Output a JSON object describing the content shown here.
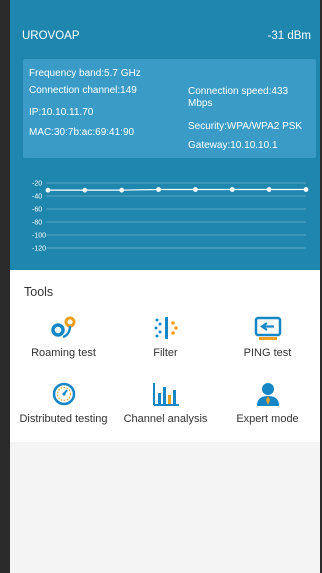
{
  "header": {
    "ssid": "UROVOAP",
    "signal_strength": "-31 dBm"
  },
  "info": {
    "frequency_band": "Frequency band:5.7 GHz",
    "connection_channel": "Connection channel:149",
    "ip": "IP:10.10.11.70",
    "mac": "MAC:30:7b:ac:69:41:90",
    "connection_speed_line1": "Connection speed:433",
    "connection_speed_line2": "Mbps",
    "security": "Security:WPA/WPA2 PSK",
    "gateway": "Gateway:10.10.10.1"
  },
  "chart_data": {
    "type": "line",
    "title": "",
    "xlabel": "",
    "ylabel": "",
    "y_ticks": [
      "-20",
      "-40",
      "-60",
      "-80",
      "-100",
      "-120"
    ],
    "ylim": [
      -120,
      -20
    ],
    "grid": true,
    "series": [
      {
        "values": [
          -31,
          -31,
          -31,
          -30,
          -30,
          -30,
          -30,
          -30
        ]
      }
    ]
  },
  "tools": {
    "title": "Tools",
    "items": [
      {
        "label": "Roaming test",
        "icon": "roaming-icon"
      },
      {
        "label": "Filter",
        "icon": "filter-icon"
      },
      {
        "label": "PING test",
        "icon": "ping-icon"
      },
      {
        "label": "Distributed testing",
        "icon": "gauge-icon"
      },
      {
        "label": "Channel analysis",
        "icon": "bar-chart-icon"
      },
      {
        "label": "Expert mode",
        "icon": "expert-icon"
      }
    ]
  },
  "colors": {
    "header_bg": "#1f86ad",
    "card_bg": "#3a9cc6",
    "accent": "#1687c4"
  }
}
